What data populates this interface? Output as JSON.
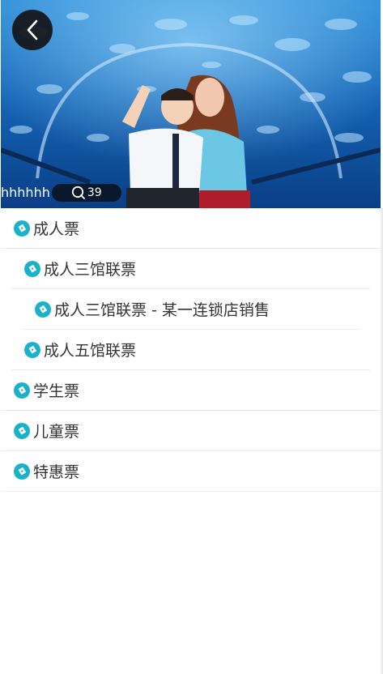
{
  "hero": {
    "title": "hhhhhh",
    "comment_count": "39"
  },
  "tickets": [
    {
      "label": "成人票",
      "level": 0
    },
    {
      "label": "成人三馆联票",
      "level": 1
    },
    {
      "label": "成人三馆联票 - 某一连锁店销售",
      "level": 2
    },
    {
      "label": "成人五馆联票",
      "level": 1
    },
    {
      "label": "学生票",
      "level": 0
    },
    {
      "label": "儿童票",
      "level": 0
    },
    {
      "label": "特惠票",
      "level": 0
    }
  ],
  "icons": {
    "back": "chevron-left-icon",
    "comment": "comment-icon",
    "ticket": "ticket-icon"
  },
  "colors": {
    "accent": "#1ab2c9",
    "text": "#333333",
    "divider": "#ebebeb"
  }
}
